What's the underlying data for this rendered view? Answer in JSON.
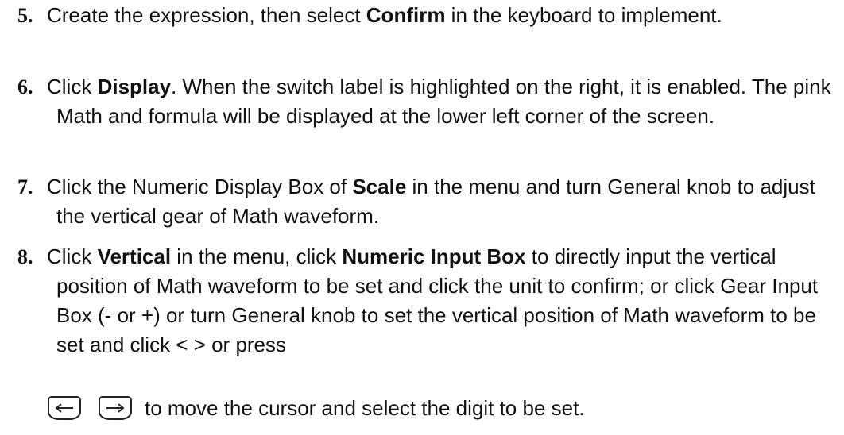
{
  "steps": [
    {
      "number": "5.",
      "parts": [
        "Create the expression, then select ",
        "Confirm",
        " in the keyboard to implement."
      ]
    },
    {
      "number": "6.",
      "parts": [
        "Click ",
        "Display",
        ". When the switch label is highlighted on the right, it is enabled. The pink Math and formula will be displayed at the lower left corner of the screen."
      ]
    },
    {
      "number": "7.",
      "parts": [
        "Click the Numeric Display Box of ",
        "Scale",
        " in the menu and turn General knob to adjust the vertical gear of Math waveform."
      ]
    },
    {
      "number": "8.",
      "parts": [
        "Click ",
        "Vertical",
        " in the menu, click ",
        "Numeric Input Box",
        " to directly input the vertical position of Math waveform to be set and click the unit to confirm; or click Gear Input Box (- or +) or turn General knob to set the vertical position of Math waveform to be set and click < > or press"
      ]
    }
  ],
  "keys_line": {
    "left_key_icon": "left-arrow-key-icon",
    "right_key_icon": "right-arrow-key-icon",
    "text": "to move the cursor and select the digit to be set."
  }
}
